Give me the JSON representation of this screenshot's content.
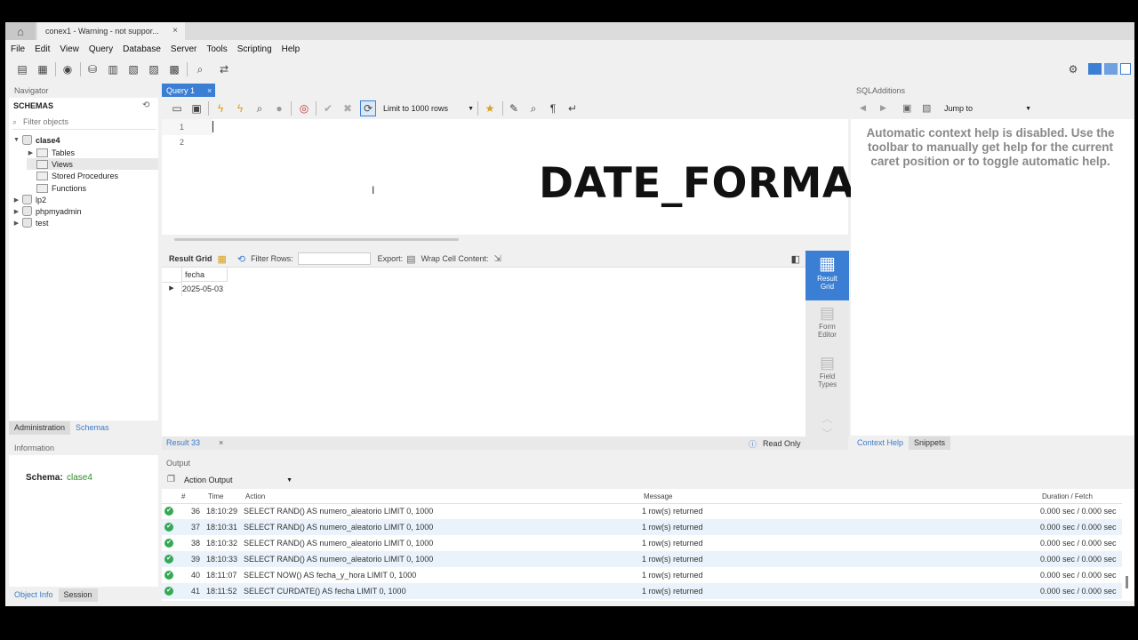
{
  "window_tab": {
    "label": "conex1 - Warning - not suppor...",
    "close": "×"
  },
  "menu": [
    "File",
    "Edit",
    "View",
    "Query",
    "Database",
    "Server",
    "Tools",
    "Scripting",
    "Help"
  ],
  "navigator": {
    "header": "Navigator",
    "schemas_label": "SCHEMAS",
    "filter_placeholder": "Filter objects",
    "tree": [
      {
        "label": "clase4",
        "level": 0,
        "expanded": true,
        "bold": true,
        "icon": "database-icon"
      },
      {
        "label": "Tables",
        "level": 1,
        "icon": "folder-icon"
      },
      {
        "label": "Views",
        "level": 1,
        "icon": "folder-icon",
        "selected": true
      },
      {
        "label": "Stored Procedures",
        "level": 1,
        "icon": "folder-icon"
      },
      {
        "label": "Functions",
        "level": 1,
        "icon": "folder-icon"
      },
      {
        "label": "lp2",
        "level": 0,
        "icon": "database-icon"
      },
      {
        "label": "phpmyadmin",
        "level": 0,
        "icon": "database-icon"
      },
      {
        "label": "test",
        "level": 0,
        "icon": "database-icon"
      }
    ],
    "tabs": [
      "Administration",
      "Schemas"
    ],
    "active_tab": "Schemas"
  },
  "information": {
    "header": "Information",
    "schema_label": "Schema:",
    "schema_value": "clase4",
    "tabs": [
      "Object Info",
      "Session"
    ]
  },
  "query": {
    "tab_label": "Query 1",
    "tab_close": "×",
    "limit_label": "Limit to 1000 rows",
    "lines": [
      "1",
      "2"
    ]
  },
  "overlay_title": "DATE_FORMAT",
  "result": {
    "grid_label": "Result Grid",
    "filter_label": "Filter Rows:",
    "export_label": "Export:",
    "wrap_label": "Wrap Cell Content:",
    "column": "fecha",
    "rows": [
      "2025-05-03"
    ],
    "side_tabs": [
      "Result Grid",
      "Form Editor",
      "Field Types"
    ],
    "tab_label": "Result 33",
    "tab_close": "×",
    "readonly_label": "Read Only"
  },
  "sql_additions": {
    "header": "SQLAdditions",
    "jump_to": "Jump to",
    "help_text": "Automatic context help is disabled. Use the toolbar to manually get help for the current caret position or to toggle automatic help.",
    "tabs": [
      "Context Help",
      "Snippets"
    ]
  },
  "output": {
    "header": "Output",
    "selector": "Action Output",
    "columns": {
      "num": "#",
      "time": "Time",
      "action": "Action",
      "message": "Message",
      "duration": "Duration / Fetch"
    },
    "rows": [
      {
        "num": "36",
        "time": "18:10:29",
        "action": "SELECT RAND() AS numero_aleatorio LIMIT 0, 1000",
        "message": "1 row(s) returned",
        "duration": "0.000 sec / 0.000 sec"
      },
      {
        "num": "37",
        "time": "18:10:31",
        "action": "SELECT RAND() AS numero_aleatorio LIMIT 0, 1000",
        "message": "1 row(s) returned",
        "duration": "0.000 sec / 0.000 sec"
      },
      {
        "num": "38",
        "time": "18:10:32",
        "action": "SELECT RAND() AS numero_aleatorio LIMIT 0, 1000",
        "message": "1 row(s) returned",
        "duration": "0.000 sec / 0.000 sec"
      },
      {
        "num": "39",
        "time": "18:10:33",
        "action": "SELECT RAND() AS numero_aleatorio LIMIT 0, 1000",
        "message": "1 row(s) returned",
        "duration": "0.000 sec / 0.000 sec"
      },
      {
        "num": "40",
        "time": "18:11:07",
        "action": "SELECT NOW() AS fecha_y_hora LIMIT 0, 1000",
        "message": "1 row(s) returned",
        "duration": "0.000 sec / 0.000 sec"
      },
      {
        "num": "41",
        "time": "18:11:52",
        "action": "SELECT CURDATE() AS fecha LIMIT 0, 1000",
        "message": "1 row(s) returned",
        "duration": "0.000 sec / 0.000 sec"
      }
    ]
  },
  "colors": {
    "accent": "#3b7fd4",
    "success": "#34a853",
    "schema_green": "#2e8b2e"
  }
}
